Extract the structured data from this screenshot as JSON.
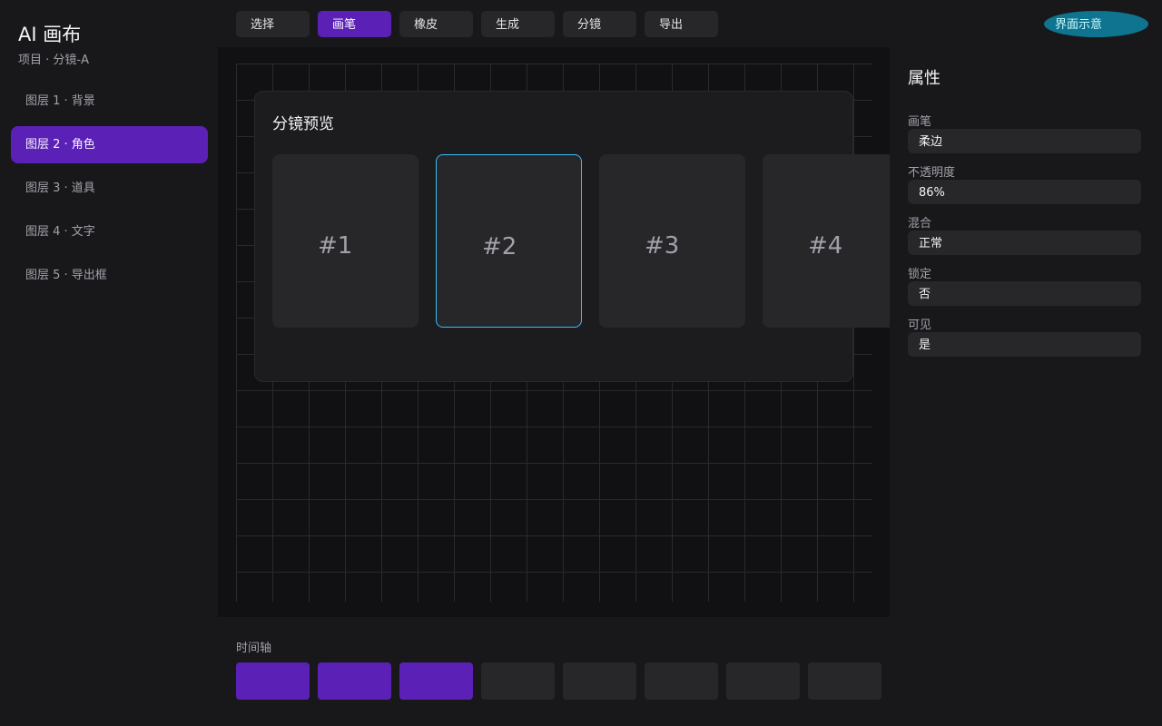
{
  "app": {
    "title": "AI 画布",
    "subtitle": "项目 · 分镜-A"
  },
  "layers": [
    {
      "label": "图层 1 · 背景",
      "active": false
    },
    {
      "label": "图层 2 · 角色",
      "active": true
    },
    {
      "label": "图层 3 · 道具",
      "active": false
    },
    {
      "label": "图层 4 · 文字",
      "active": false
    },
    {
      "label": "图层 5 · 导出框",
      "active": false
    }
  ],
  "toolbar": {
    "tools": [
      {
        "label": "选择",
        "active": false
      },
      {
        "label": "画笔",
        "active": true
      },
      {
        "label": "橡皮",
        "active": false
      },
      {
        "label": "生成",
        "active": false
      },
      {
        "label": "分镜",
        "active": false
      },
      {
        "label": "导出",
        "active": false
      }
    ],
    "badge": "界面示意"
  },
  "storyboard": {
    "title": "分镜预览",
    "frames": [
      {
        "label": "#1",
        "selected": false
      },
      {
        "label": "#2",
        "selected": true
      },
      {
        "label": "#3",
        "selected": false
      },
      {
        "label": "#4",
        "selected": false
      }
    ]
  },
  "properties": {
    "title": "属性",
    "items": [
      {
        "label": "画笔",
        "value": "柔边"
      },
      {
        "label": "不透明度",
        "value": "86%"
      },
      {
        "label": "混合",
        "value": "正常"
      },
      {
        "label": "锁定",
        "value": "否"
      },
      {
        "label": "可见",
        "value": "是"
      }
    ]
  },
  "timeline": {
    "label": "时间轴",
    "cells": [
      true,
      true,
      true,
      false,
      false,
      false,
      false,
      false
    ]
  },
  "colors": {
    "accent": "#5b21b6",
    "selection": "#38bdf8",
    "badge": "#0e7490",
    "background": "#18181b",
    "canvas": "#111113"
  }
}
